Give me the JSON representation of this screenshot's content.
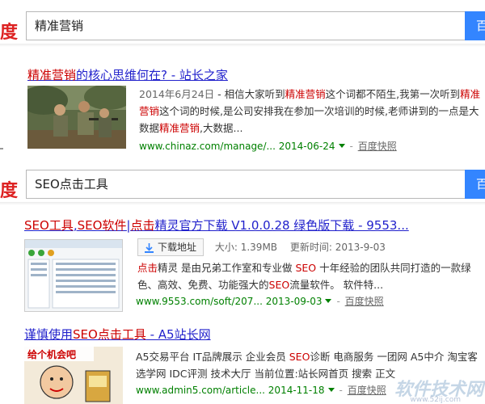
{
  "search1": {
    "logo_fragment": "度",
    "query": "精准营销",
    "button": "百度一下"
  },
  "result1": {
    "title_hl": "精准营销",
    "title_rest": "的核心思维何在? - 站长之家",
    "snippet_date": "2014年6月24日",
    "snippet_parts": [
      "- 相信大家听到",
      "精准营销",
      "这个词都不陌生,我第一次听到",
      "精准营销",
      "这个词的时候,是公司安排我在参加一次培训的时候,老师讲到的一点是大数据",
      "精准营销",
      ",大数据..."
    ],
    "url": "www.chinaz.com/manage/...",
    "date": "2014-06-24",
    "cache": "百度快照"
  },
  "search2": {
    "logo_fragment": "度",
    "query": "SEO点击工具",
    "button": "百度一下"
  },
  "result2": {
    "title_parts": [
      "SEO工具",
      ",",
      "SEO软件",
      "|",
      "点击",
      "精灵官方下载 V1.0.0.28 绿色版下载 - 9553..."
    ],
    "download_label": "下载地址",
    "size_label": "大小:",
    "size_value": "1.39MB",
    "updated_label": "更新时间:",
    "updated_value": "2013-9-03",
    "snippet_parts": [
      "点击",
      "精灵 是由兄弟工作室和专业做 ",
      "SEO",
      " 十年经验的团队共同打造的一款绿色、高效、免费、功能强大的",
      "SEO",
      "流量软件。 软件特..."
    ],
    "url": "www.9553.com/soft/207...",
    "date": "2013-09-03",
    "cache": "百度快照"
  },
  "result3": {
    "title_prefix": "谨慎使用",
    "title_hl": "SEO点击工具",
    "title_rest": " - A5站长网",
    "snippet_parts": [
      "A5交易平台 IT品牌展示 企业会员 ",
      "SEO",
      "诊断 电商服务 一团网 A5中介 淘宝客 选学网 IDC评测 技术大厅 当前位置:站长网首页 搜索 正文"
    ],
    "url": "www.admin5.com/article...",
    "date": "2014-11-18",
    "cache": "百度快照",
    "thumb_text": "给个机会吧"
  },
  "watermark": {
    "text": "软件技术网",
    "sub": "www.52ij.com"
  },
  "colors": {
    "link": "#2222cc",
    "highlight": "#cc0000",
    "url_green": "#008000",
    "button_blue": "#3385ff",
    "logo_red": "#dd2222"
  }
}
